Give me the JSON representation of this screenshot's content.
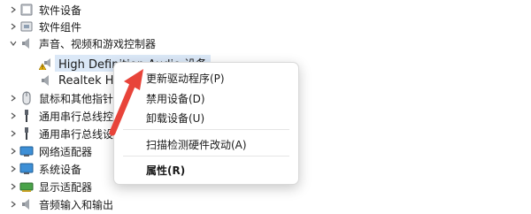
{
  "tree": {
    "rows": [
      {
        "label": "软件设备",
        "chevron": "right",
        "icon": "software-device-icon"
      },
      {
        "label": "软件组件",
        "chevron": "right",
        "icon": "software-component-icon"
      },
      {
        "label": "声音、视频和游戏控制器",
        "chevron": "down",
        "icon": "speaker-icon"
      },
      {
        "label": "High Definition Audio 设备",
        "chevron": "",
        "icon": "warning-speaker-icon"
      },
      {
        "label": "Realtek Hi",
        "chevron": "",
        "icon": "speaker-icon"
      },
      {
        "label": "鼠标和其他指针",
        "chevron": "right",
        "icon": "mouse-icon"
      },
      {
        "label": "通用串行总线控",
        "chevron": "right",
        "icon": "usb-icon"
      },
      {
        "label": "通用串行总线设",
        "chevron": "right",
        "icon": "usb-icon"
      },
      {
        "label": "网络适配器",
        "chevron": "right",
        "icon": "network-adapter-icon"
      },
      {
        "label": "系统设备",
        "chevron": "right",
        "icon": "system-device-icon"
      },
      {
        "label": "显示适配器",
        "chevron": "right",
        "icon": "display-adapter-icon"
      },
      {
        "label": "音频输入和输出",
        "chevron": "right",
        "icon": "audio-io-icon"
      }
    ]
  },
  "context_menu": {
    "update_driver": "更新驱动程序(P)",
    "disable_device": "禁用设备(D)",
    "uninstall_device": "卸载设备(U)",
    "scan_hardware": "扫描检测硬件改动(A)",
    "properties": "属性(R)"
  },
  "colors": {
    "selection": "#dbe8f7",
    "arrow": "#e8443a"
  }
}
